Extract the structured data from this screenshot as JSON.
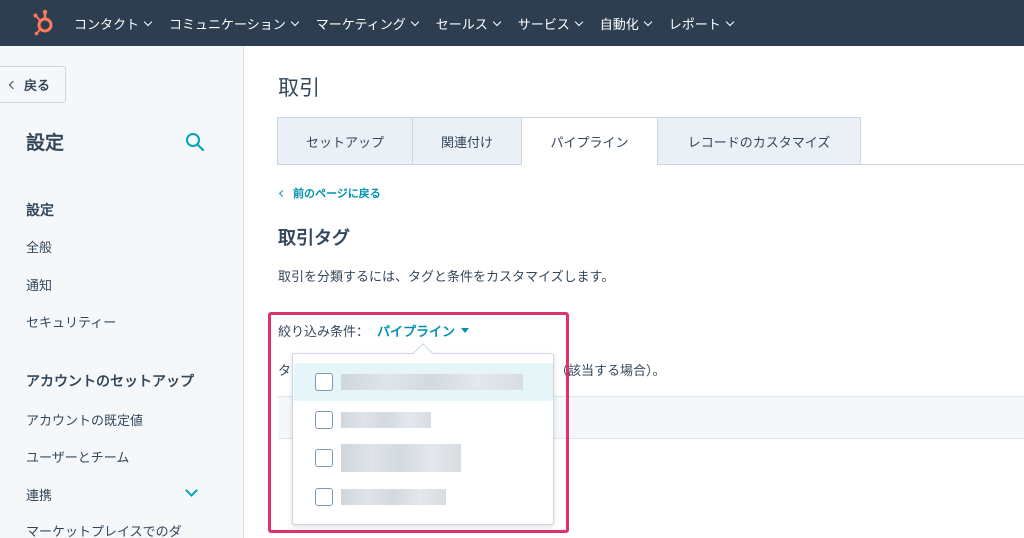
{
  "topnav": {
    "items": [
      {
        "label": "コンタクト"
      },
      {
        "label": "コミュニケーション"
      },
      {
        "label": "マーケティング"
      },
      {
        "label": "セールス"
      },
      {
        "label": "サービス"
      },
      {
        "label": "自動化"
      },
      {
        "label": "レポート"
      }
    ],
    "brand_color": "#ff7a59"
  },
  "sidebar": {
    "back_label": "戻る",
    "title": "設定",
    "sections": [
      {
        "heading": "設定",
        "items": [
          "全般",
          "通知",
          "セキュリティー"
        ]
      },
      {
        "heading": "アカウントのセットアップ",
        "items": [
          "アカウントの既定値",
          "ユーザーとチーム",
          "連携",
          "マーケットプレイスでのダ"
        ]
      }
    ]
  },
  "main": {
    "title": "取引",
    "tabs": [
      {
        "label": "セットアップ",
        "active": false
      },
      {
        "label": "関連付け",
        "active": false
      },
      {
        "label": "パイプライン",
        "active": true
      },
      {
        "label": "レコードのカスタマイズ",
        "active": false
      }
    ],
    "back_link": "前のページに戻る",
    "section_title": "取引タグ",
    "description": "取引を分類するには、タグと条件をカスタマイズします。",
    "filter_label": "絞り込み条件：",
    "filter_value": "パイプライン",
    "row2_left": "タ",
    "row2_right": "（該当する場合）。"
  },
  "dropdown": {
    "option_count_shown": 4
  },
  "colors": {
    "nav_bg": "#2d3e50",
    "accent": "#0091ae",
    "highlight": "#e0326a"
  }
}
